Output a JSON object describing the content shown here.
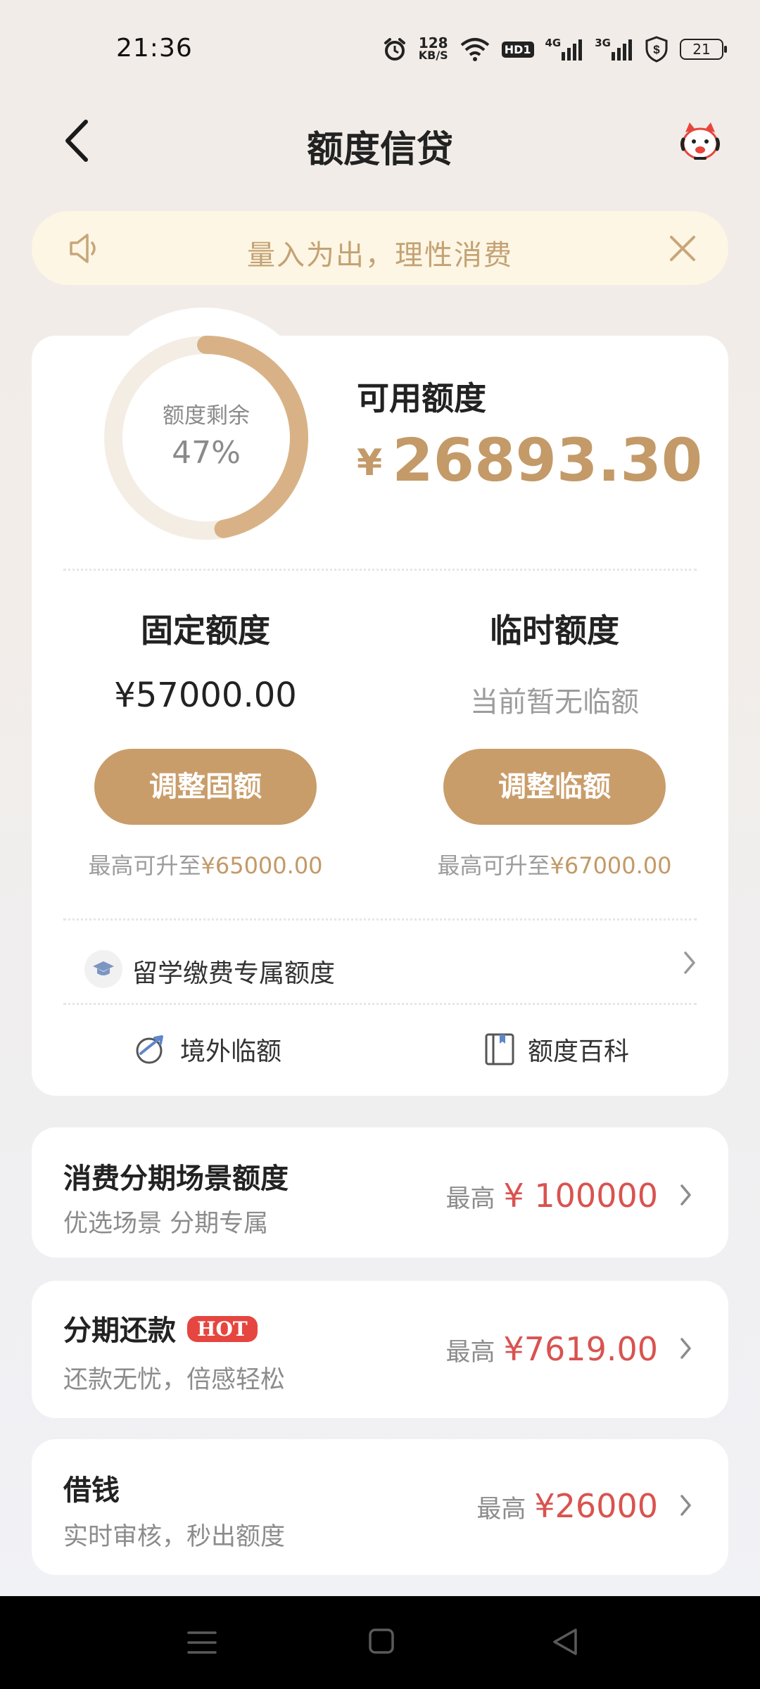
{
  "status_bar": {
    "time": "21:36",
    "net_speed_value": "128",
    "net_speed_unit": "KB/S",
    "hd_label": "HD1",
    "signal1_label": "4G",
    "signal2_label": "3G",
    "battery_level": "21"
  },
  "header": {
    "title": "额度信贷"
  },
  "notice": {
    "text": "量入为出，理性消费"
  },
  "credit": {
    "ring_label": "额度剩余",
    "ring_percent": "47%",
    "remaining_fraction": 0.47,
    "available_label": "可用额度",
    "available_currency": "¥",
    "available_amount": "26893.30",
    "fixed": {
      "title": "固定额度",
      "value": "¥57000.00",
      "button": "调整固额",
      "note_prefix": "最高可升至",
      "note_amount": "¥65000.00"
    },
    "temporary": {
      "title": "临时额度",
      "value": "当前暂无临额",
      "button": "调整临额",
      "note_prefix": "最高可升至",
      "note_amount": "¥67000.00"
    },
    "study_label": "留学缴费专属额度",
    "links": {
      "overseas": "境外临额",
      "wiki": "额度百科"
    }
  },
  "products": [
    {
      "title": "消费分期场景额度",
      "subtitle": "优选场景 分期专属",
      "prefix": "最高",
      "amount": "¥ 100000"
    },
    {
      "title": "分期还款",
      "badge": "HOT",
      "subtitle": "还款无忧，倍感轻松",
      "prefix": "最高",
      "amount": "¥7619.00"
    },
    {
      "title": "借钱",
      "subtitle": "实时审核，秒出额度",
      "prefix": "最高",
      "amount": "¥26000"
    }
  ],
  "colors": {
    "accent": "#c99d6a",
    "accent_text": "#c39a68",
    "amount_red": "#d9534f",
    "hot_badge": "#e5463f",
    "notice_bg": "#fdf6e4"
  }
}
